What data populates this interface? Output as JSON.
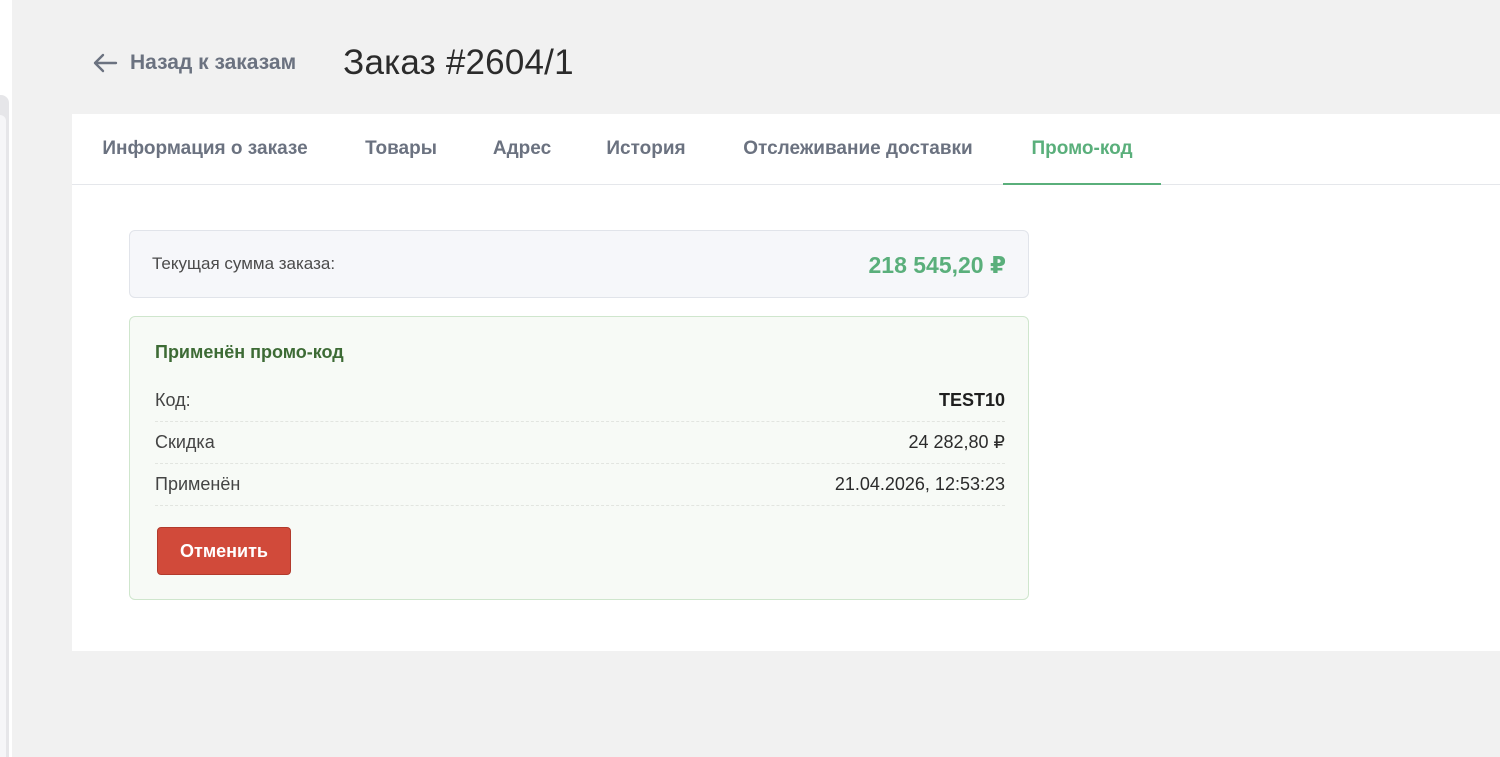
{
  "header": {
    "back_label": "Назад к заказам",
    "order_title": "Заказ #2604/1"
  },
  "tabs": [
    {
      "label": "Информация о заказе",
      "active": false
    },
    {
      "label": "Товары",
      "active": false
    },
    {
      "label": "Адрес",
      "active": false
    },
    {
      "label": "История",
      "active": false
    },
    {
      "label": "Отслеживание доставки",
      "active": false
    },
    {
      "label": "Промо-код",
      "active": true
    }
  ],
  "summary": {
    "label": "Текущая сумма заказа:",
    "value": "218 545,20 ₽"
  },
  "promo": {
    "title": "Применён промо-код",
    "rows": [
      {
        "key": "Код:",
        "value": "TEST10"
      },
      {
        "key": "Скидка",
        "value": "24 282,80 ₽"
      },
      {
        "key": "Применён",
        "value": "21.04.2026, 12:53:23"
      }
    ],
    "cancel_label": "Отменить"
  },
  "colors": {
    "accent_green": "#5aaf7b",
    "promo_title_green": "#3d6b35",
    "danger_red": "#d14a3a",
    "page_background": "#f1f1f1"
  },
  "icons": {
    "back": "arrow-left-icon"
  }
}
